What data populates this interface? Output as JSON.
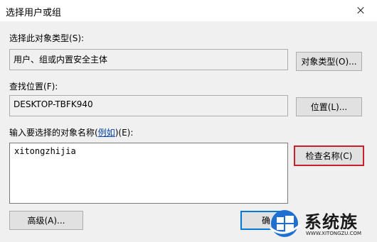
{
  "window": {
    "title": "选择用户或组"
  },
  "object_type": {
    "label": "选择此对象类型",
    "hotkey_text": "(S):",
    "value": "用户、组或内置安全主体",
    "button": "对象类型(O)..."
  },
  "location": {
    "label": "查找位置",
    "hotkey_text": "(F):",
    "value": "DESKTOP-TBFK940",
    "button": "位置(L)..."
  },
  "names": {
    "label": "输入要选择的对象名称",
    "example_paren_open": "(",
    "example_link": "例如",
    "example_paren_close": ")(E):",
    "value": "xitongzhijia",
    "check_button": "检查名称(C)"
  },
  "buttons": {
    "advanced": "高级(A)...",
    "ok_partial": "确"
  },
  "watermark": {
    "text": "系统族",
    "url": "WWW.XITONGZU.COM"
  },
  "colors": {
    "highlight_border": "#cc1f2e",
    "link": "#0645ad",
    "primary_border": "#0078d7"
  }
}
